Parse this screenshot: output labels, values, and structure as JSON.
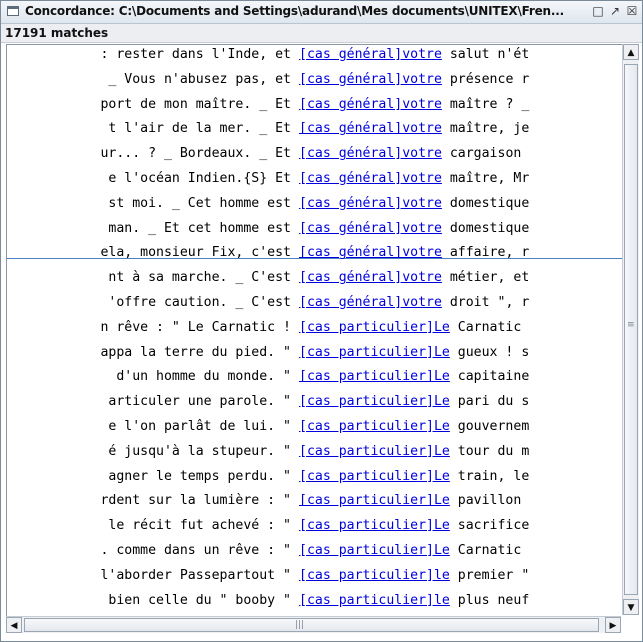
{
  "window": {
    "title": "Concordance: C:\\Documents and Settings\\adurand\\Mes documents\\UNITEX\\Fren...",
    "minimize_glyph": "□",
    "maximize_glyph": "↗",
    "close_glyph": "☒"
  },
  "match_count": "17191 matches",
  "rows": [
    {
      "left": ": rester dans l'Inde, et",
      "match": "[cas général]votre",
      "right": " salut n'ét"
    },
    {
      "left": "_ Vous n'abusez pas, et",
      "match": "[cas général]votre",
      "right": " présence r"
    },
    {
      "left": "port de mon maître. _ Et",
      "match": "[cas général]votre",
      "right": " maître ? _"
    },
    {
      "left": "t l'air de la mer. _ Et",
      "match": "[cas général]votre",
      "right": " maître, je"
    },
    {
      "left": "ur... ? _ Bordeaux. _ Et",
      "match": "[cas général]votre",
      "right": " cargaison"
    },
    {
      "left": "e l'océan Indien.{S} Et",
      "match": "[cas général]votre",
      "right": " maître, Mr"
    },
    {
      "left": "st moi. _ Cet homme est",
      "match": "[cas général]votre",
      "right": " domestique"
    },
    {
      "left": "man. _ Et cet homme est",
      "match": "[cas général]votre",
      "right": " domestique"
    },
    {
      "left": "ela, monsieur Fix, c'est",
      "match": "[cas général]votre",
      "right": " affaire, r"
    },
    {
      "left": "nt à sa marche. _ C'est",
      "match": "[cas général]votre",
      "right": " métier, et"
    },
    {
      "left": "'offre caution. _ C'est",
      "match": "[cas général]votre",
      "right": " droit \", r"
    },
    {
      "left": "n rêve : \" Le Carnatic !",
      "match": "[cas particulier]Le",
      "right": " Carnatic"
    },
    {
      "left": "appa la terre du pied. \"",
      "match": "[cas particulier]Le",
      "right": " gueux ! s"
    },
    {
      "left": "d'un homme du monde. \"",
      "match": "[cas particulier]Le",
      "right": " capitaine"
    },
    {
      "left": "articuler une parole. \"",
      "match": "[cas particulier]Le",
      "right": " pari du s"
    },
    {
      "left": "e l'on parlât de lui. \"",
      "match": "[cas particulier]Le",
      "right": " gouvernem"
    },
    {
      "left": "é jusqu'à la stupeur. \"",
      "match": "[cas particulier]Le",
      "right": " tour du m"
    },
    {
      "left": "agner le temps perdu. \"",
      "match": "[cas particulier]Le",
      "right": " train, le"
    },
    {
      "left": "rdent sur la lumière : \"",
      "match": "[cas particulier]Le",
      "right": " pavillon"
    },
    {
      "left": "le récit fut achevé : \"",
      "match": "[cas particulier]Le",
      "right": " sacrifice"
    },
    {
      "left": ". comme dans un rêve : \"",
      "match": "[cas particulier]Le",
      "right": " Carnatic"
    },
    {
      "left": "l'aborder Passepartout \"",
      "match": "[cas particulier]le",
      "right": " premier \""
    },
    {
      "left": "bien celle du \" booby \"",
      "match": "[cas particulier]le",
      "right": " plus neuf"
    }
  ],
  "scroll_glyphs": {
    "up": "▲",
    "down": "▼",
    "left": "◀",
    "right": "▶",
    "grip": "≡",
    "hgrip": "|||"
  }
}
